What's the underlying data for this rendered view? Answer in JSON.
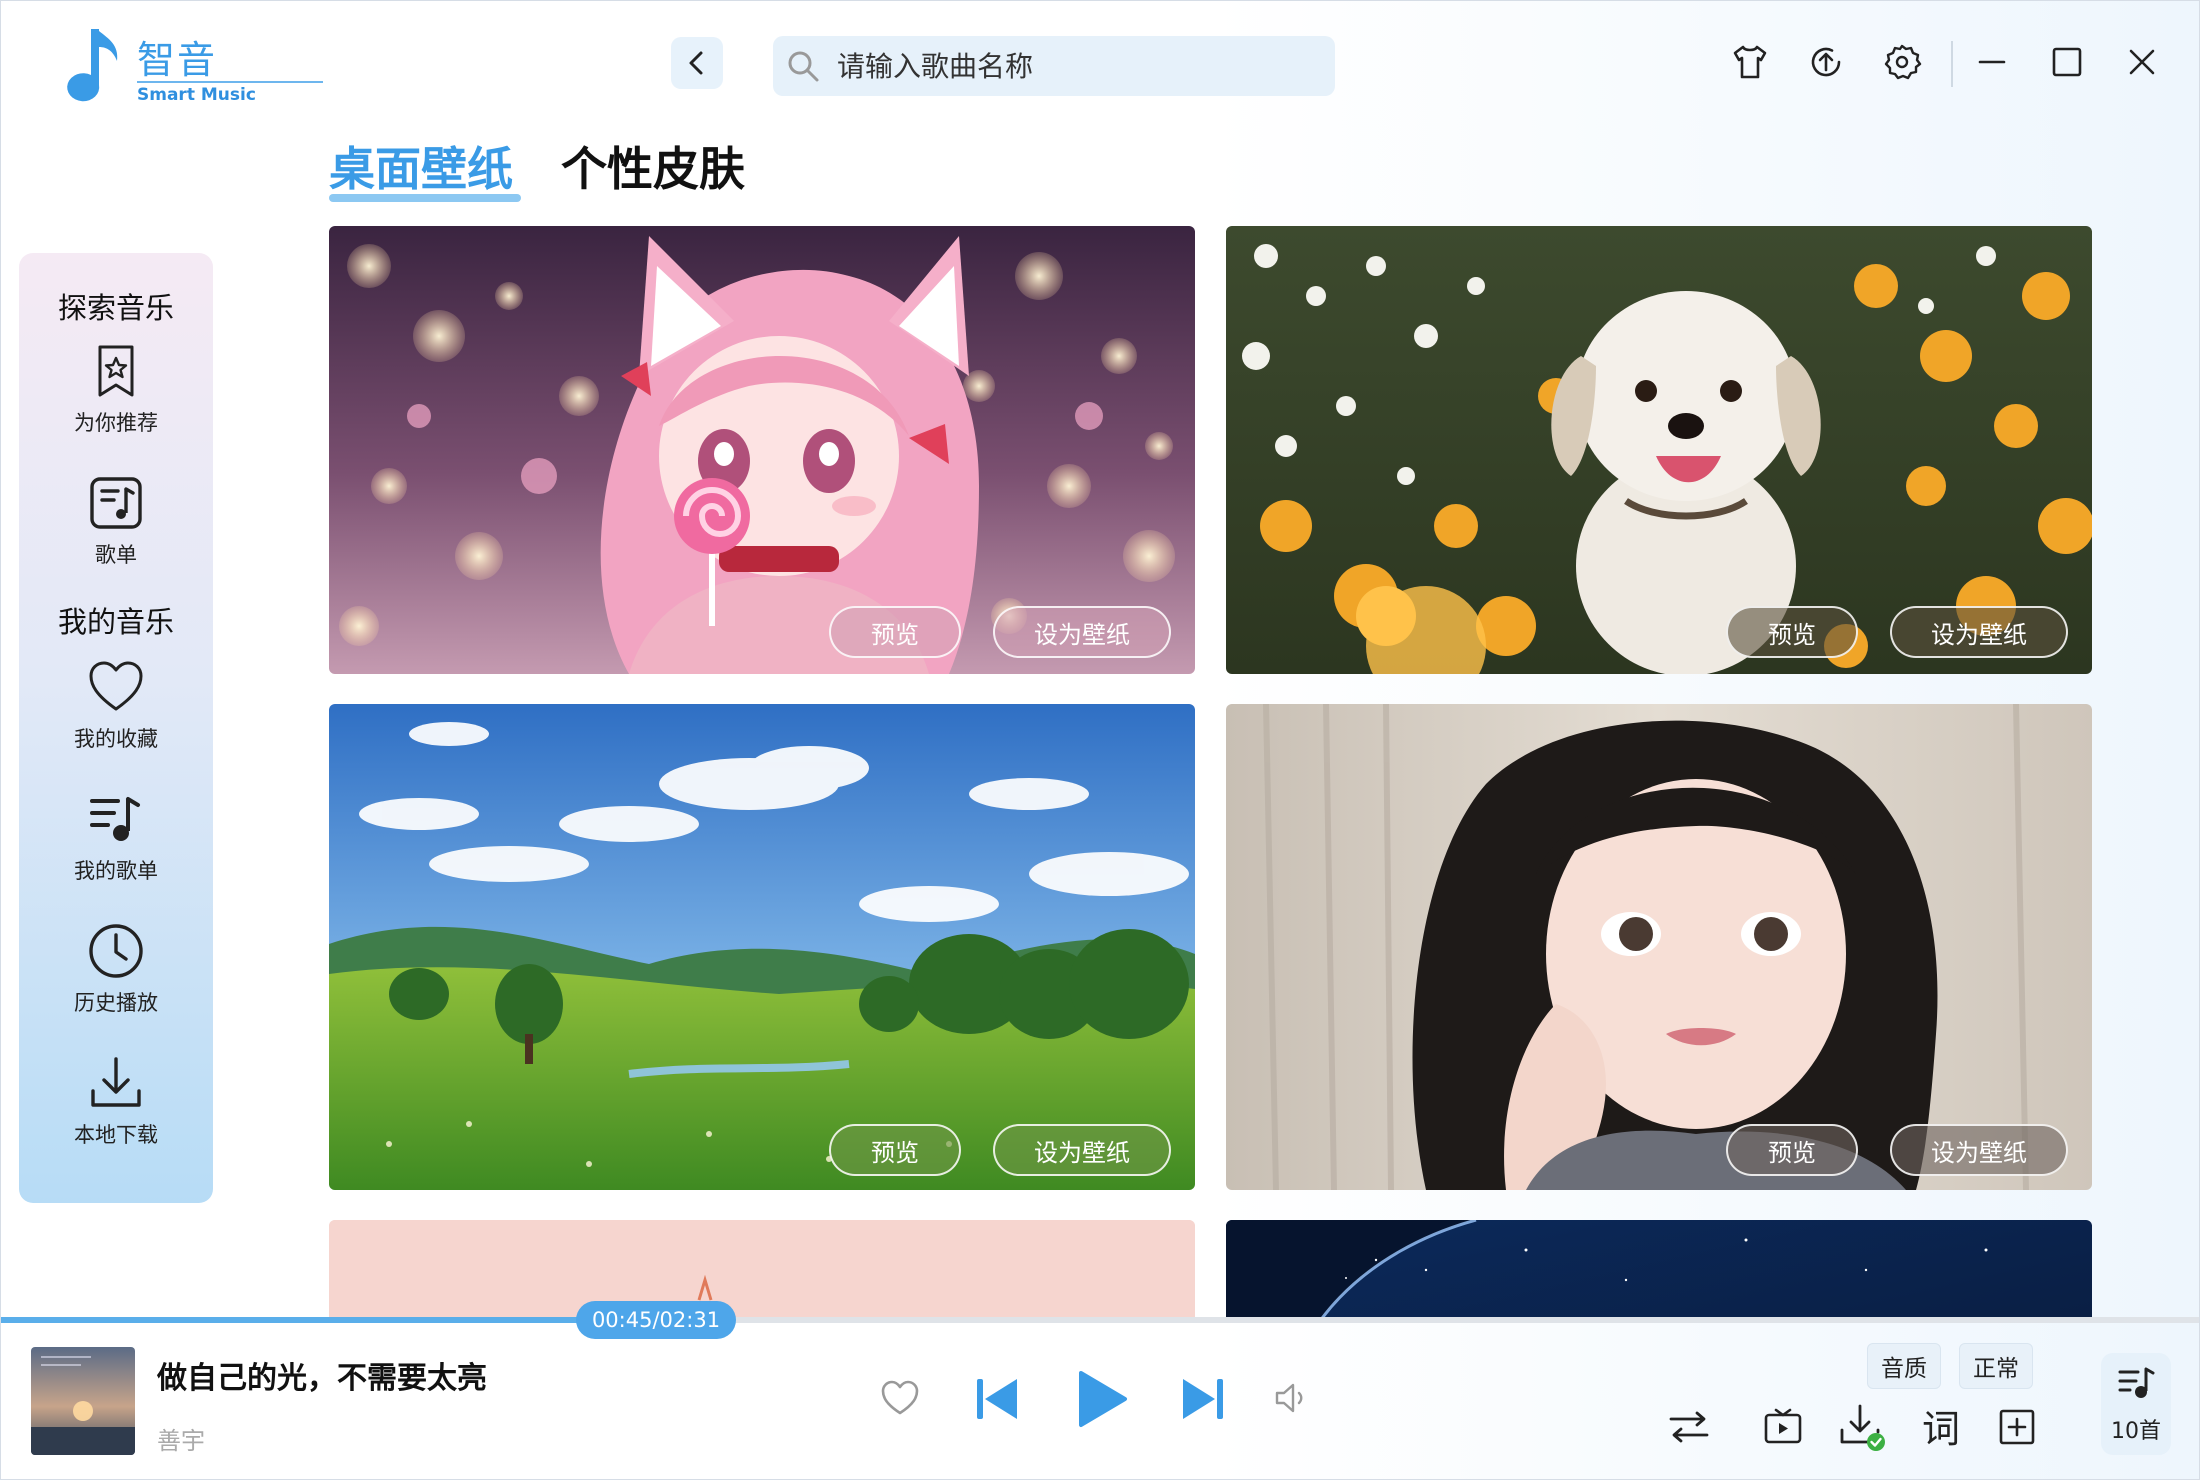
{
  "app": {
    "name": "智音",
    "subtitle": "Smart Music",
    "accent_color": "#3a9be6"
  },
  "header": {
    "back_icon": "chevron-left-icon",
    "search_placeholder": "请输入歌曲名称",
    "icons": [
      "skin-shirt-icon",
      "upload-icon",
      "gear-icon",
      "minimize-icon",
      "maximize-icon",
      "close-icon"
    ]
  },
  "tabs": [
    {
      "label": "桌面壁纸",
      "active": true
    },
    {
      "label": "个性皮肤",
      "active": false
    }
  ],
  "sidebar": {
    "sections": [
      {
        "title": "探索音乐",
        "items": [
          {
            "label": "为你推荐",
            "icon": "star-bookmark-icon"
          },
          {
            "label": "歌单",
            "icon": "music-list-icon"
          }
        ]
      },
      {
        "title": "我的音乐",
        "items": [
          {
            "label": "我的收藏",
            "icon": "heart-icon"
          },
          {
            "label": "我的歌单",
            "icon": "my-playlist-icon"
          },
          {
            "label": "历史播放",
            "icon": "clock-icon"
          },
          {
            "label": "本地下载",
            "icon": "download-icon"
          }
        ]
      }
    ]
  },
  "wallpapers": {
    "preview_label": "预览",
    "set_label": "设为壁纸"
  },
  "player": {
    "current_time": "00:45",
    "total_time": "02:31",
    "time_text": "00:45/02:31",
    "progress": 0.298,
    "song_title": "做自己的光，不需要太亮",
    "artist": "善宇",
    "quality_label": "音质",
    "quality_value": "正常",
    "lyrics_label": "词",
    "playlist_count": "10首"
  }
}
